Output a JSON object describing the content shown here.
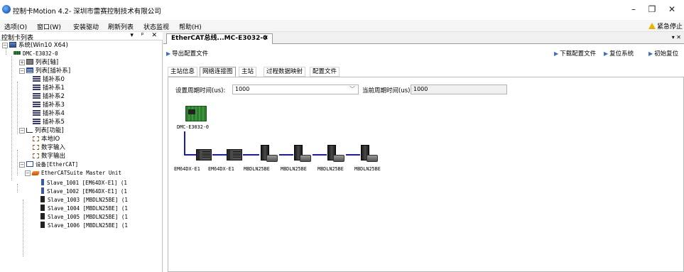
{
  "window": {
    "title": "控制卡Motion 4.2- 深圳市雷赛控制技术有限公司",
    "minimize": "–",
    "maximize": "❐",
    "close": "✕"
  },
  "menu": {
    "items": [
      "选项(O)",
      "窗口(W)",
      "安装驱动",
      "刷新列表",
      "状态监视",
      "帮助(H)"
    ],
    "estop": "紧急停止"
  },
  "left": {
    "title": "控制卡列表",
    "controls": "▾ ᵖ ✕",
    "tree": [
      "系统(Win10 X64)",
      "DMC-E3032-0",
      "列表[轴]",
      "列表[插补系]",
      "插补系0",
      "插补系1",
      "插补系2",
      "插补系3",
      "插补系4",
      "插补系5",
      "列表[功能]",
      "本地IO",
      "数字输入",
      "数字输出",
      "设备[EtherCAT]",
      "EtherCATSuite Master Unit",
      "Slave_1001 [EM64DX-E1] (1",
      "Slave_1002 [EM64DX-E1] (1",
      "Slave_1003 [MBDLN25BE] (1",
      "Slave_1004 [MBDLN25BE] (1",
      "Slave_1005 [MBDLN25BE] (1",
      "Slave_1006 [MBDLN25BE] (1"
    ]
  },
  "doc": {
    "tab": "EtherCAT总线...MC-E3032-0",
    "tab_close": "✕",
    "dropdown": "▾ ✕"
  },
  "toolbar": {
    "export": "导出配置文件",
    "download": "下载配置文件",
    "reset": "复位系统",
    "init": "初始复位"
  },
  "subtabs": [
    "主站信息",
    "网络连接图",
    "主站",
    "过程数据映射",
    "配置文件"
  ],
  "active_subtab": "网络连接图",
  "cycle": {
    "set_label": "设置周期时间(us):",
    "set_value": "1000",
    "current_label": "当前周期时间(us):",
    "current_value": "1000"
  },
  "topology": {
    "master": "DMC-E3032-0",
    "slaves": [
      "EM64DX-E1",
      "EM64DX-E1",
      "MBDLN25BE",
      "MBDLN25BE",
      "MBDLN25BE",
      "MBDLN25BE"
    ],
    "line_color": "#1818c8"
  },
  "colors": {
    "accent": "#3b6fc2",
    "warn": "#e8b400"
  }
}
